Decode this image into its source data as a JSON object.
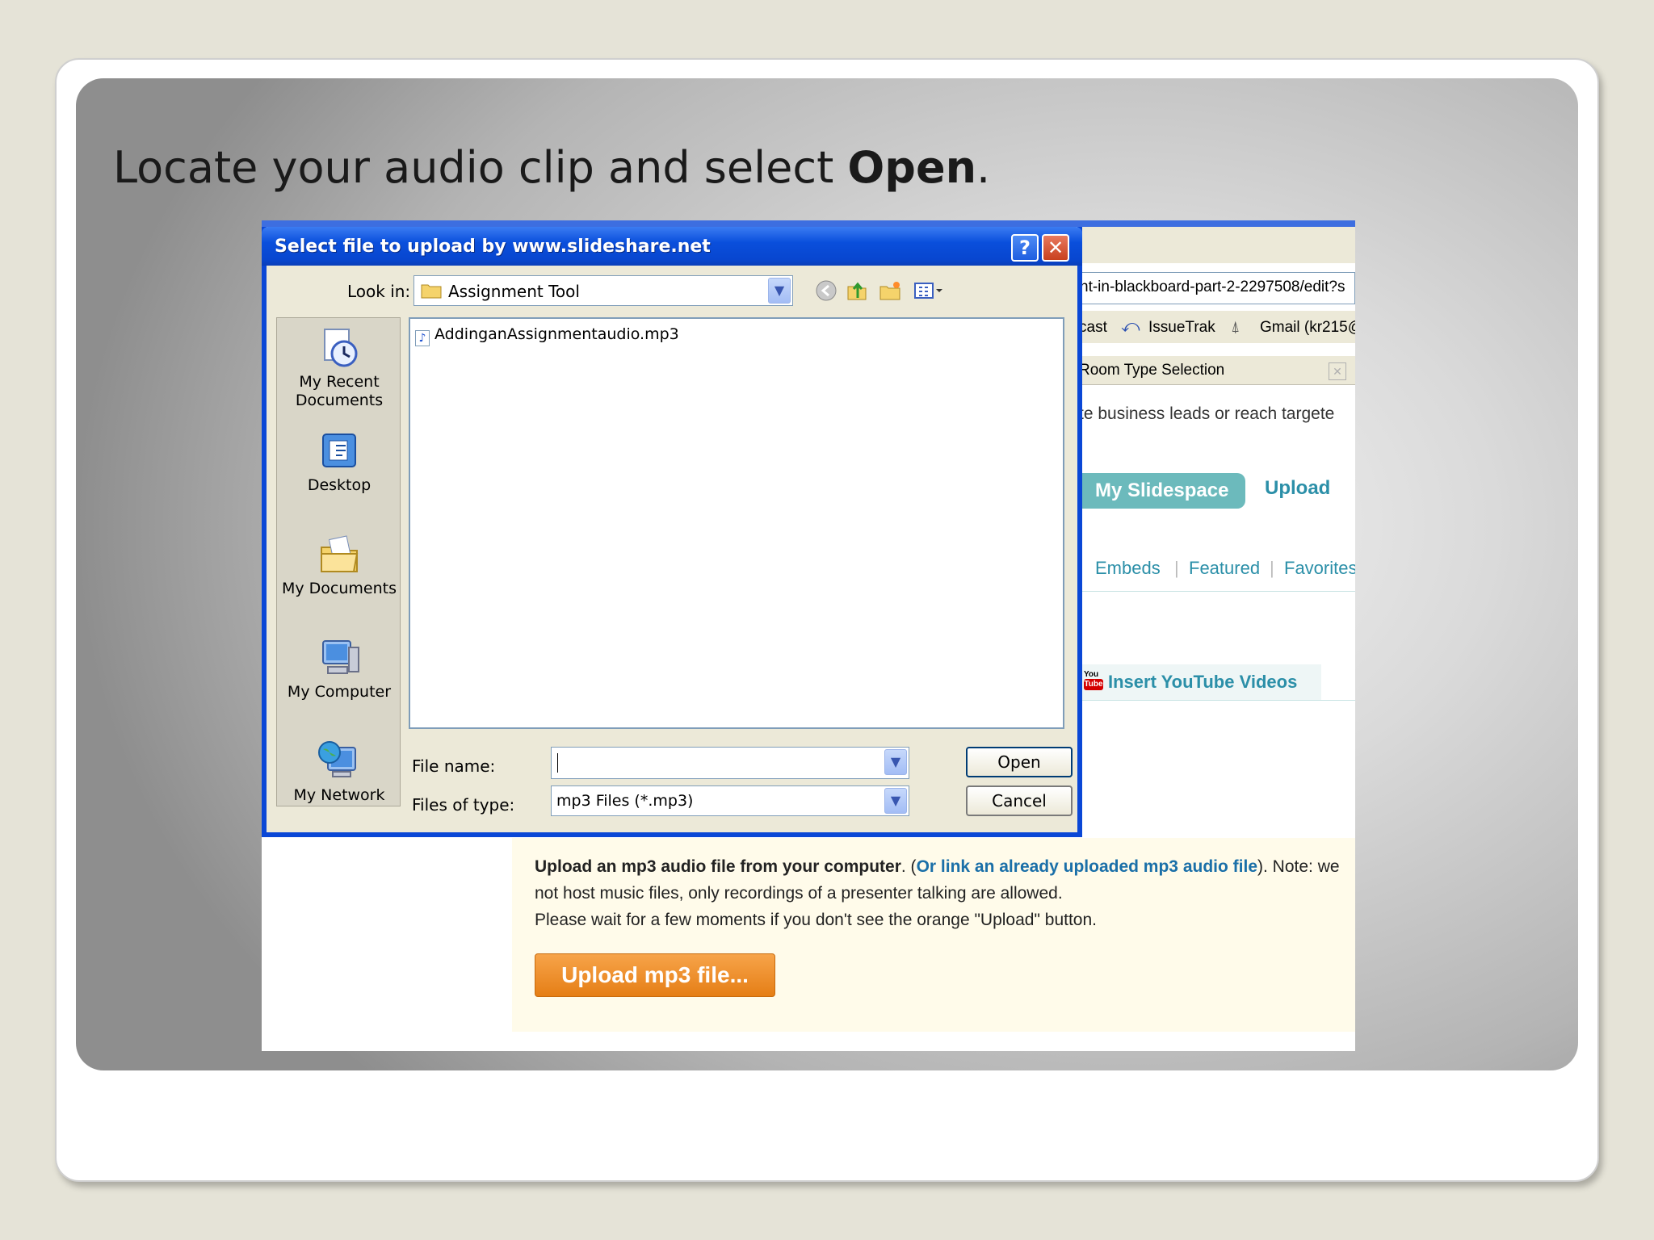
{
  "slide": {
    "title_prefix": "Locate your audio clip and select ",
    "title_bold": "Open",
    "title_suffix": "."
  },
  "browser": {
    "address_fragment": "nt-in-blackboard-part-2-2297508/edit?s",
    "links": [
      "cast",
      "IssueTrak",
      "Gmail (kr215@"
    ],
    "tab_title": "Room Type Selection",
    "ad_text": "te business leads or reach targete"
  },
  "site": {
    "nav_my_slidespace": "My Slidespace",
    "nav_upload": "Upload",
    "subnav": [
      "Embeds",
      "Featured",
      "Favorites"
    ],
    "youtube_you": "You",
    "youtube_tube": "Tube",
    "youtube_label": "Insert YouTube Videos",
    "mp3_line1_bold": "Upload an mp3 audio file from your computer",
    "mp3_line1_mid": ". (",
    "mp3_line1_link": "Or link an already uploaded mp3 audio file",
    "mp3_line1_end": "). Note: we",
    "mp3_line2": "not host music files, only recordings of a presenter talking are allowed.",
    "mp3_line3": "Please wait for a few moments if you don't see the orange \"Upload\" button.",
    "upload_button": "Upload mp3 file..."
  },
  "dialog": {
    "title": "Select file to upload by www.slideshare.net",
    "help_btn": "?",
    "close_btn": "✕",
    "look_in_label": "Look in:",
    "look_in_value": "Assignment Tool",
    "places": [
      "My Recent\nDocuments",
      "Desktop",
      "My Documents",
      "My Computer",
      "My Network"
    ],
    "files": [
      "AddinganAssignmentaudio.mp3"
    ],
    "file_name_label": "File name:",
    "file_name_value": "",
    "files_of_type_label": "Files of type:",
    "files_of_type_value": "mp3 Files (*.mp3)",
    "open_button": "Open",
    "cancel_button": "Cancel"
  },
  "colors": {
    "xp_title_blue": "#0a47d6",
    "teal": "#2b8fa8",
    "orange": "#e57e15"
  }
}
